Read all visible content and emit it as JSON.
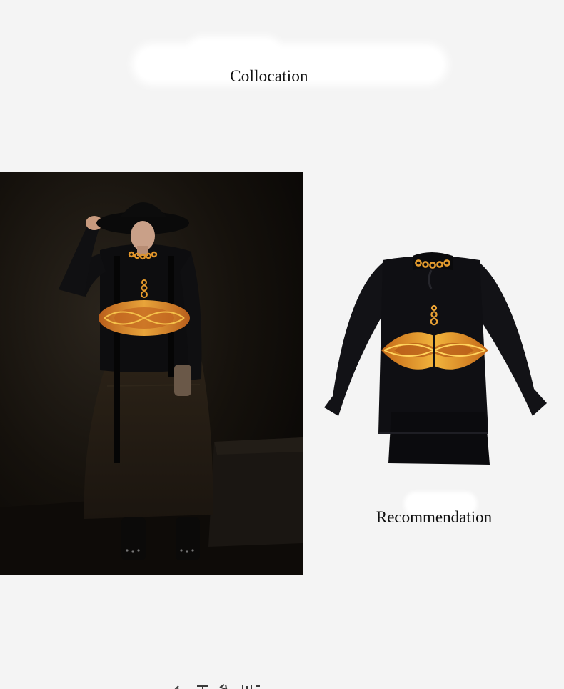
{
  "header": {
    "title": "Collocation"
  },
  "recommendation": {
    "title": "Recommendation"
  },
  "images": {
    "lifestyle_photo": "model-wearing-black-embroidered-shirt",
    "product_photo": "black-shirt-with-orange-embroidery"
  },
  "colors": {
    "background": "#f4f4f4",
    "garment": "#111114",
    "embroidery": "#e09224"
  }
}
